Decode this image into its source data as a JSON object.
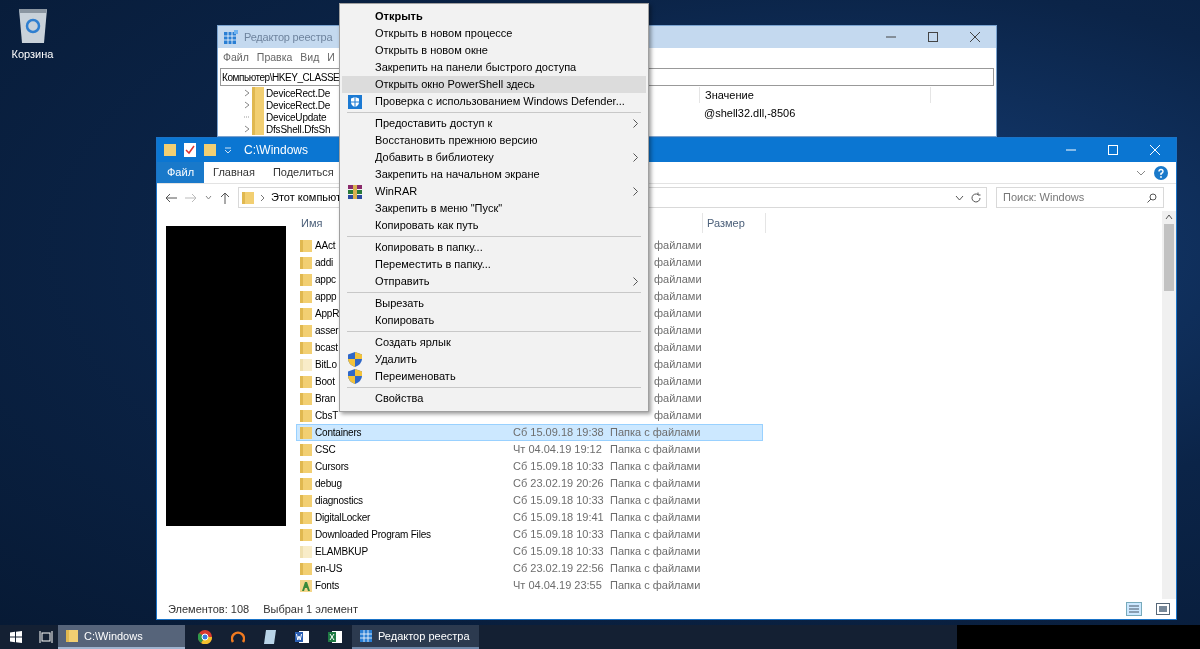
{
  "desktop": {
    "icons": [
      {
        "label": "Корзина"
      }
    ]
  },
  "registry_window": {
    "title": "Редактор реестра",
    "menu": [
      "Файл",
      "Правка",
      "Вид",
      "И"
    ],
    "address": "Компьютер\\HKEY_CLASSE",
    "tree": [
      {
        "label": "DeviceRect.De",
        "expandable": true
      },
      {
        "label": "DeviceRect.De",
        "expandable": true
      },
      {
        "label": "DeviceUpdate",
        "expandable": false
      },
      {
        "label": "DfsShell.DfsSh",
        "expandable": true
      }
    ],
    "columns": [
      "Значение"
    ],
    "value": "@shell32.dll,-8506"
  },
  "explorer": {
    "title": "C:\\Windows",
    "tabs": [
      {
        "label": "Файл",
        "selected": true
      },
      {
        "label": "Главная",
        "selected": false
      },
      {
        "label": "Поделиться",
        "selected": false
      }
    ],
    "breadcrumb": "Этот компьют",
    "search": {
      "placeholder": "Поиск: Windows"
    },
    "columns": [
      "Имя",
      "Размер"
    ],
    "rows": [
      {
        "name": "AAct",
        "type": "файлами",
        "kind": "folder",
        "selected": false
      },
      {
        "name": "addi",
        "type": "файлами",
        "kind": "folder",
        "selected": false
      },
      {
        "name": "appc",
        "type": "файлами",
        "kind": "folder",
        "selected": false
      },
      {
        "name": "appp",
        "type": "файлами",
        "kind": "folder",
        "selected": false
      },
      {
        "name": "AppR",
        "type": "файлами",
        "kind": "folder",
        "selected": false
      },
      {
        "name": "asser",
        "type": "файлами",
        "kind": "folder",
        "selected": false
      },
      {
        "name": "bcast",
        "type": "файлами",
        "kind": "folder",
        "selected": false
      },
      {
        "name": "BitLo",
        "type": "файлами",
        "kind": "empty-folder",
        "selected": false
      },
      {
        "name": "Boot",
        "type": "файлами",
        "kind": "folder",
        "selected": false
      },
      {
        "name": "Bran",
        "type": "файлами",
        "kind": "folder",
        "selected": false
      },
      {
        "name": "CbsT",
        "type": "файлами",
        "kind": "folder",
        "selected": false
      },
      {
        "name": "Containers",
        "date": "Сб 15.09.18 19:38",
        "type": "Папка с файлами",
        "kind": "folder",
        "selected": true
      },
      {
        "name": "CSC",
        "date": "Чт 04.04.19 19:12",
        "type": "Папка с файлами",
        "kind": "folder",
        "selected": false
      },
      {
        "name": "Cursors",
        "date": "Сб 15.09.18 10:33",
        "type": "Папка с файлами",
        "kind": "folder",
        "selected": false
      },
      {
        "name": "debug",
        "date": "Сб 23.02.19 20:26",
        "type": "Папка с файлами",
        "kind": "folder",
        "selected": false
      },
      {
        "name": "diagnostics",
        "date": "Сб 15.09.18 10:33",
        "type": "Папка с файлами",
        "kind": "folder",
        "selected": false
      },
      {
        "name": "DigitalLocker",
        "date": "Сб 15.09.18 19:41",
        "type": "Папка с файлами",
        "kind": "folder",
        "selected": false
      },
      {
        "name": "Downloaded Program Files",
        "date": "Сб 15.09.18 10:33",
        "type": "Папка с файлами",
        "kind": "folder",
        "selected": false
      },
      {
        "name": "ELAMBKUP",
        "date": "Сб 15.09.18 10:33",
        "type": "Папка с файлами",
        "kind": "empty-folder",
        "selected": false
      },
      {
        "name": "en-US",
        "date": "Сб 23.02.19 22:56",
        "type": "Папка с файлами",
        "kind": "folder",
        "selected": false
      },
      {
        "name": "Fonts",
        "date": "Чт 04.04.19 23:55",
        "type": "Папка с файлами",
        "kind": "fonts",
        "selected": false
      }
    ],
    "status": [
      "Элементов: 108",
      "Выбран 1 элемент"
    ]
  },
  "context_menu": {
    "groups": [
      [
        {
          "label": "Открыть",
          "kind": "plain",
          "default": true,
          "selected": false,
          "submenu": false
        },
        {
          "label": "Открыть в новом процессе",
          "kind": "plain",
          "default": false,
          "selected": false,
          "submenu": false
        },
        {
          "label": "Открыть в новом окне",
          "kind": "plain",
          "default": false,
          "selected": false,
          "submenu": false
        },
        {
          "label": "Закрепить на панели быстрого доступа",
          "kind": "plain",
          "default": false,
          "selected": false,
          "submenu": false
        },
        {
          "label": "Открыть окно PowerShell здесь",
          "kind": "plain",
          "default": false,
          "selected": true,
          "submenu": false
        },
        {
          "label": "Проверка с использованием Windows Defender...",
          "kind": "scan",
          "default": false,
          "selected": false,
          "submenu": false
        }
      ],
      [
        {
          "label": "Предоставить доступ к",
          "kind": "plain",
          "default": false,
          "selected": false,
          "submenu": true
        },
        {
          "label": "Восстановить прежнюю версию",
          "kind": "plain",
          "default": false,
          "selected": false,
          "submenu": false
        },
        {
          "label": "Добавить в библиотеку",
          "kind": "plain",
          "default": false,
          "selected": false,
          "submenu": true
        },
        {
          "label": "Закрепить на начальном экране",
          "kind": "plain",
          "default": false,
          "selected": false,
          "submenu": false
        },
        {
          "label": "WinRAR",
          "kind": "archive",
          "default": false,
          "selected": false,
          "submenu": true
        },
        {
          "label": "Закрепить в меню \"Пуск\"",
          "kind": "plain",
          "default": false,
          "selected": false,
          "submenu": false
        },
        {
          "label": "Копировать как путь",
          "kind": "plain",
          "default": false,
          "selected": false,
          "submenu": false
        }
      ],
      [
        {
          "label": "Копировать в папку...",
          "kind": "plain",
          "default": false,
          "selected": false,
          "submenu": false
        },
        {
          "label": "Переместить в папку...",
          "kind": "plain",
          "default": false,
          "selected": false,
          "submenu": false
        },
        {
          "label": "Отправить",
          "kind": "plain",
          "default": false,
          "selected": false,
          "submenu": true
        }
      ],
      [
        {
          "label": "Вырезать",
          "kind": "plain",
          "default": false,
          "selected": false,
          "submenu": false
        },
        {
          "label": "Копировать",
          "kind": "plain",
          "default": false,
          "selected": false,
          "submenu": false
        }
      ],
      [
        {
          "label": "Создать ярлык",
          "kind": "plain",
          "default": false,
          "selected": false,
          "submenu": false
        },
        {
          "label": "Удалить",
          "kind": "elevated",
          "default": false,
          "selected": false,
          "submenu": false
        },
        {
          "label": "Переименовать",
          "kind": "elevated",
          "default": false,
          "selected": false,
          "submenu": false
        }
      ],
      [
        {
          "label": "Свойства",
          "kind": "plain",
          "default": false,
          "selected": false,
          "submenu": false
        }
      ]
    ]
  },
  "taskbar": {
    "windows": [
      {
        "label": "C:\\Windows",
        "selected": true
      },
      {
        "label": "Редактор реестра",
        "selected": false
      }
    ]
  }
}
